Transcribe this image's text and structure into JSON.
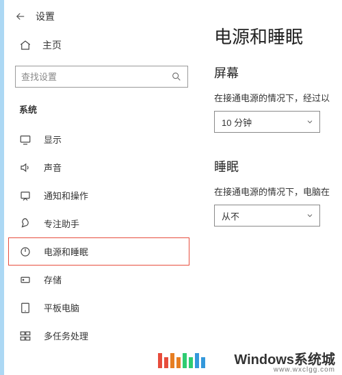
{
  "window": {
    "title": "设置"
  },
  "home": {
    "label": "主页"
  },
  "search": {
    "placeholder": "查找设置"
  },
  "category": {
    "label": "系统"
  },
  "sidebar": {
    "items": [
      {
        "label": "显示"
      },
      {
        "label": "声音"
      },
      {
        "label": "通知和操作"
      },
      {
        "label": "专注助手"
      },
      {
        "label": "电源和睡眠"
      },
      {
        "label": "存储"
      },
      {
        "label": "平板电脑"
      },
      {
        "label": "多任务处理"
      }
    ]
  },
  "content": {
    "title": "电源和睡眠",
    "screen": {
      "heading": "屏幕",
      "desc": "在接通电源的情况下，经过以",
      "value": "10 分钟"
    },
    "sleep": {
      "heading": "睡眠",
      "desc": "在接通电源的情况下，电脑在",
      "value": "从不"
    }
  },
  "footer": {
    "brand": "Windows系统城",
    "sub": "www.wxclgg.com"
  }
}
